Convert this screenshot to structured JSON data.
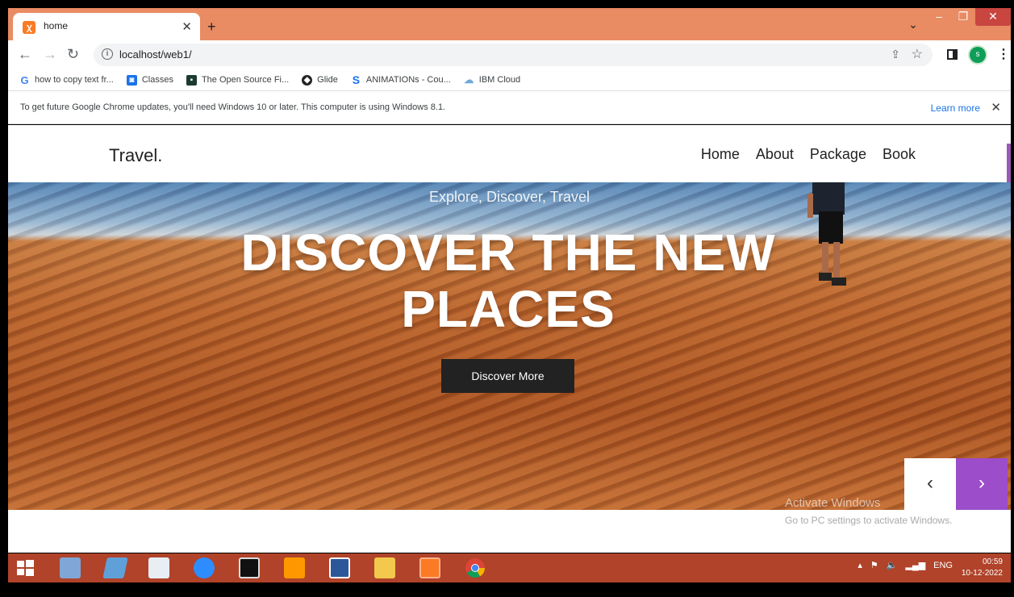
{
  "browser": {
    "tab_title": "home",
    "new_tab": "+",
    "url": "localhost/web1/",
    "profile_initial": "s",
    "bookmarks": [
      {
        "label": "how to copy text fr..."
      },
      {
        "label": "Classes"
      },
      {
        "label": "The Open Source Fi..."
      },
      {
        "label": "Glide"
      },
      {
        "label": "ANIMATIONs - Cou..."
      },
      {
        "label": "IBM Cloud"
      }
    ],
    "infobar": {
      "message": "To get future Google Chrome updates, you'll need Windows 10 or later. This computer is using Windows 8.1.",
      "learn_more": "Learn more"
    }
  },
  "page": {
    "logo": "Travel.",
    "nav": [
      "Home",
      "About",
      "Package",
      "Book"
    ],
    "hero": {
      "tagline": "Explore, Discover, Travel",
      "headline": "DISCOVER THE NEW PLACES",
      "cta": "Discover More"
    },
    "carousel": {
      "prev": "‹",
      "next": "›"
    }
  },
  "watermark": {
    "line1": "Activate Windows",
    "line2": "Go to PC settings to activate Windows."
  },
  "taskbar": {
    "language": "ENG",
    "time": "00:59",
    "date": "10-12-2022"
  },
  "colors": {
    "tab_strip": "#e98b63",
    "taskbar": "#b0432a",
    "accent": "#9b4dca"
  }
}
